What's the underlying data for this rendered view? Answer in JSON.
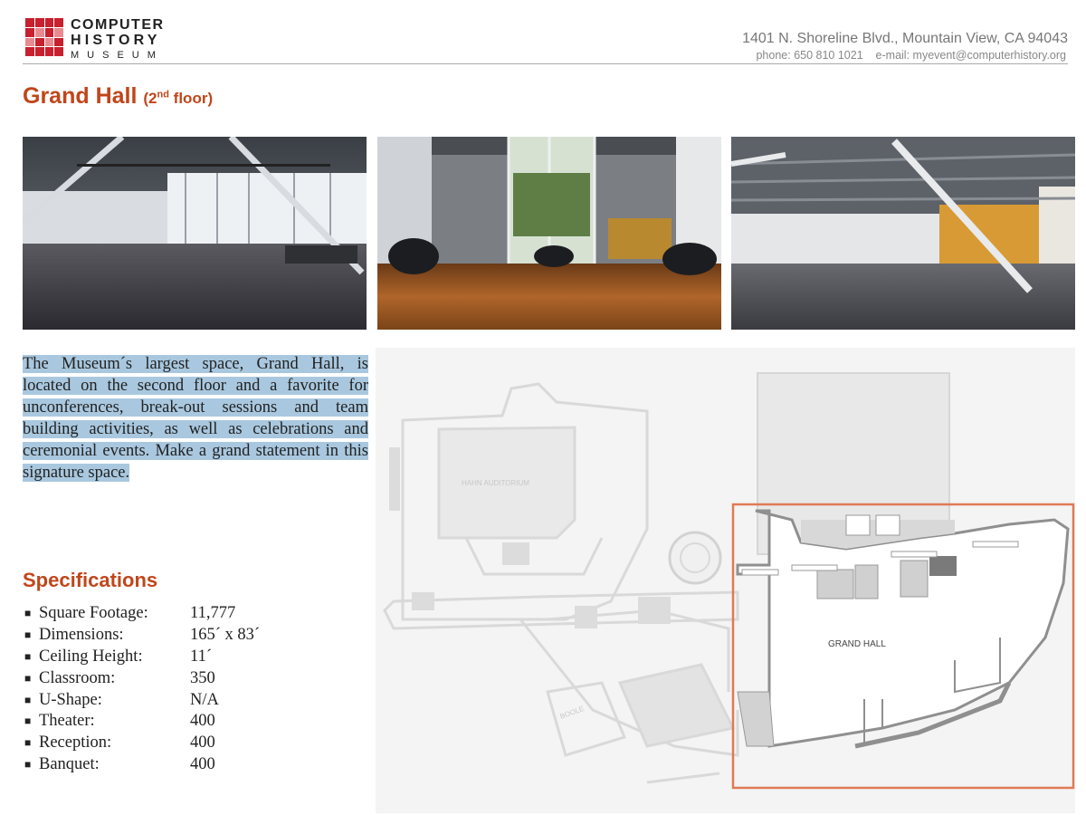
{
  "header": {
    "logo_line1": "COMPUTER",
    "logo_line2": "HISTORY",
    "logo_line3": "MUSEUM",
    "address": "1401 N. Shoreline Blvd., Mountain View, CA 94043",
    "contact": "phone: 650 810 1021    e-mail: myevent@computerhistory.org"
  },
  "title": {
    "main": "Grand Hall",
    "paren_open": "(2",
    "sup": "nd",
    "paren_close": " floor)"
  },
  "description": "The Museum´s largest space, Grand Hall, is located on the second floor and a favorite for unconferences, break-out sessions and team building activities, as well as celebrations and ceremonial events. Make a grand statement in this signature space.",
  "specifications": {
    "heading": "Specifications",
    "items": [
      {
        "label": "Square Footage:",
        "value": "11,777"
      },
      {
        "label": "Dimensions:",
        "value": "165´ x 83´"
      },
      {
        "label": "Ceiling Height:",
        "value": "11´"
      },
      {
        "label": "Classroom:",
        "value": "350"
      },
      {
        "label": "U-Shape:",
        "value": "N/A"
      },
      {
        "label": "Theater:",
        "value": "400"
      },
      {
        "label": "Reception:",
        "value": "400"
      },
      {
        "label": "Banquet:",
        "value": "400"
      }
    ]
  },
  "floor_plan": {
    "auditorium_label": "HAHN AUDITORIUM",
    "grand_hall_label": "GRAND HALL",
    "lobby_label": "BOOLE",
    "highlight_color": "#e07a55"
  },
  "colors": {
    "accent": "#c0461b",
    "highlight": "#a9c8df"
  }
}
